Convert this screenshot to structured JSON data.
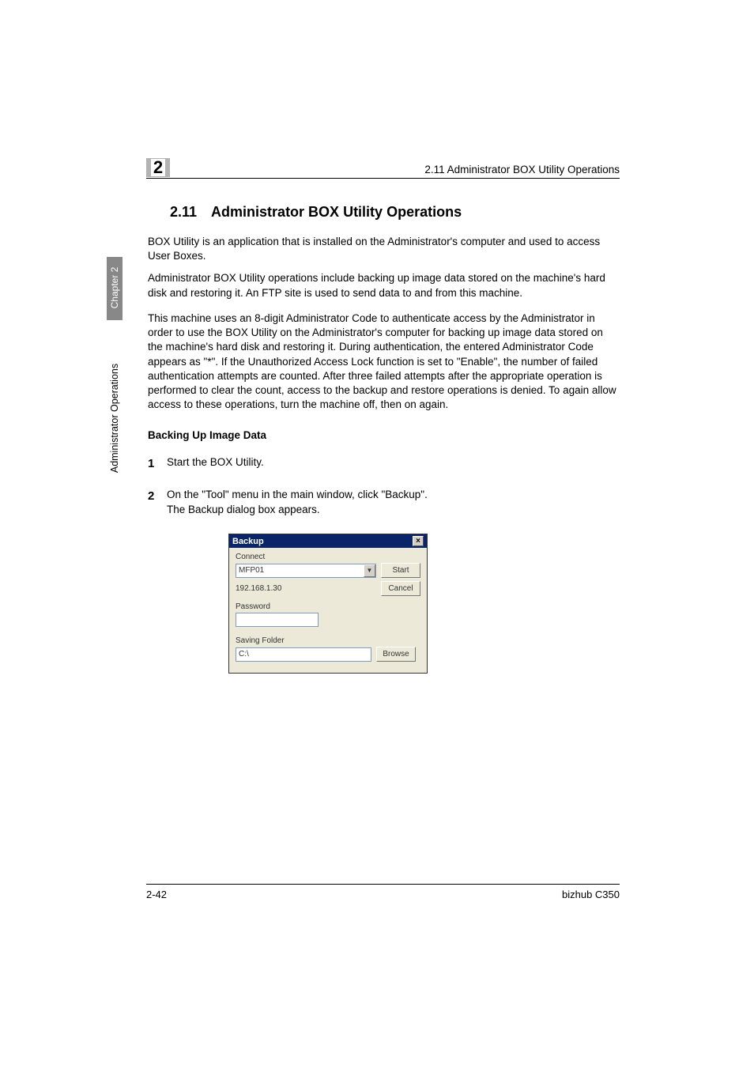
{
  "header": {
    "running_head": "2.11 Administrator BOX Utility Operations",
    "chapter_number": "2"
  },
  "side": {
    "chapter_tab": "Chapter 2",
    "section_tab": "Administrator Operations"
  },
  "section": {
    "number": "2.11",
    "title": "Administrator BOX Utility Operations"
  },
  "paragraphs": {
    "p1": "BOX Utility is an application that is installed on the Administrator's computer and used to access User Boxes.",
    "p2": "Administrator BOX Utility operations include backing up image data stored on the machine's hard disk and restoring it. An FTP site is used to send data to and from this machine.",
    "p3": "This machine uses an 8-digit Administrator Code to authenticate access by the Administrator in order to use the BOX Utility on the Administrator's computer for backing up image data stored on the machine's hard disk and restoring it. During authentication, the entered Administrator Code appears as \"*\". If the Unauthorized Access Lock function is set to \"Enable\", the number of failed authentication attempts are counted. After three failed attempts after the appropriate operation is performed to clear the count, access to the backup and restore operations is denied. To again allow access to these operations, turn the machine off, then on again."
  },
  "subheading": "Backing Up Image Data",
  "steps": {
    "s1": "Start the BOX Utility.",
    "s2a": "On the \"Tool\" menu in the main window, click \"Backup\".",
    "s2b": "The Backup dialog box appears."
  },
  "dialog": {
    "title": "Backup",
    "connect_label": "Connect",
    "connect_value": "MFP01",
    "ip_text": "192.168.1.30",
    "start": "Start",
    "cancel": "Cancel",
    "password_label": "Password",
    "saving_folder_label": "Saving Folder",
    "saving_folder_value": "C:\\",
    "browse": "Browse"
  },
  "footer": {
    "page": "2-42",
    "product": "bizhub C350"
  }
}
